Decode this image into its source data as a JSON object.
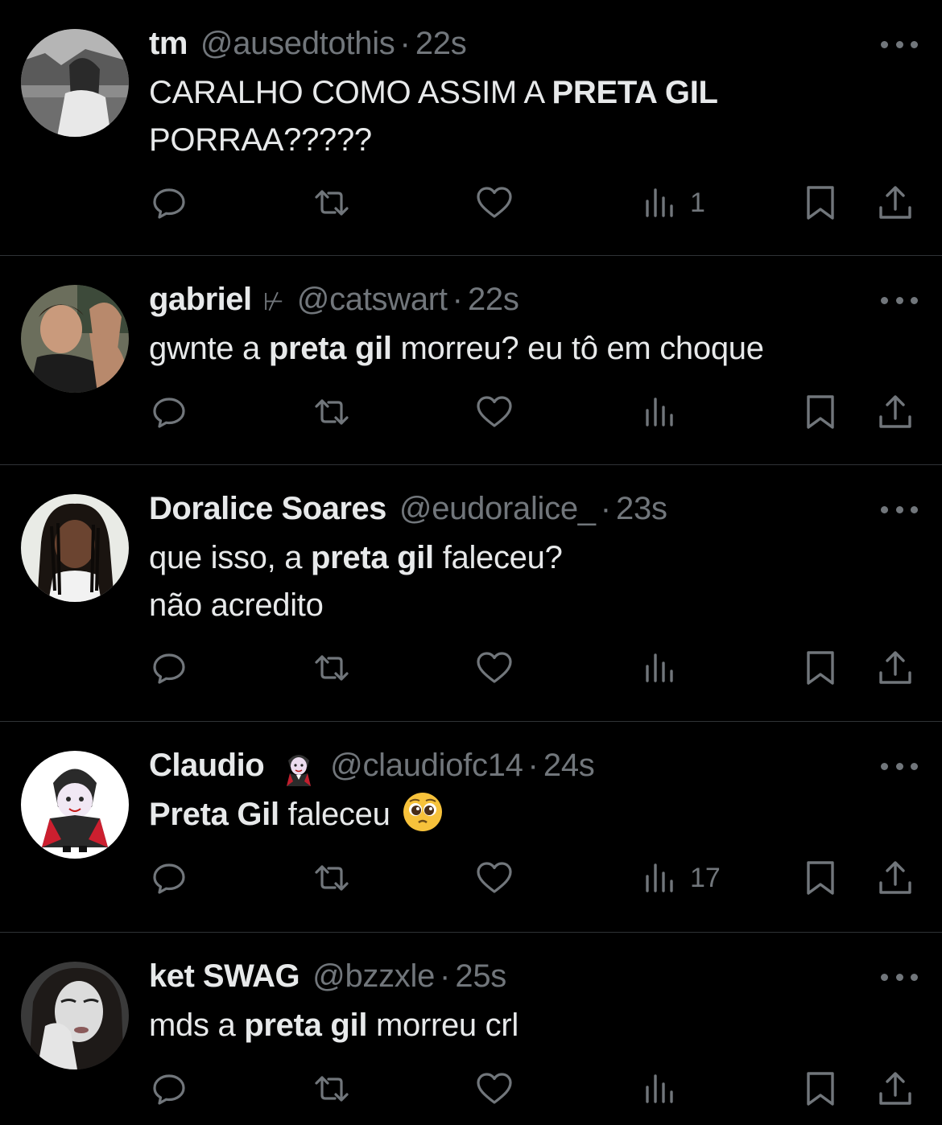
{
  "tweets": [
    {
      "name": "tm",
      "badge": "",
      "handle": "@ausedtothis",
      "separator": "·",
      "time": "22s",
      "lines": [
        [
          {
            "t": "CARALHO COMO ASSIM A ",
            "b": false
          },
          {
            "t": "PRETA GIL",
            "b": true
          }
        ],
        [
          {
            "t": "PORRAA?????",
            "b": false
          }
        ]
      ],
      "views": "1"
    },
    {
      "name": "gabriel",
      "badge": "⊬",
      "handle": "@catswart",
      "separator": "·",
      "time": "22s",
      "lines": [
        [
          {
            "t": "gwnte a ",
            "b": false
          },
          {
            "t": "preta gil",
            "b": true
          },
          {
            "t": " morreu? eu tô em choque",
            "b": false
          }
        ]
      ],
      "views": ""
    },
    {
      "name": "Doralice Soares",
      "badge": "",
      "handle": "@eudoralice_",
      "separator": "·",
      "time": "23s",
      "lines": [
        [
          {
            "t": "que isso, a ",
            "b": false
          },
          {
            "t": "preta gil",
            "b": true
          },
          {
            "t": " faleceu?",
            "b": false
          }
        ],
        [
          {
            "t": "não acredito",
            "b": false
          }
        ]
      ],
      "views": ""
    },
    {
      "name": "Claudio",
      "badge": "",
      "name_emoji": "vampire-emoji",
      "handle": "@claudiofc14",
      "separator": "·",
      "time": "24s",
      "lines": [
        [
          {
            "t": "Preta Gil",
            "b": true
          },
          {
            "t": " faleceu",
            "b": false
          }
        ]
      ],
      "text_emoji": "pleading-face-emoji",
      "views": "17"
    },
    {
      "name": "ket SWAG",
      "badge": "",
      "handle": "@bzzxle",
      "separator": "·",
      "time": "25s",
      "lines": [
        [
          {
            "t": "mds a ",
            "b": false
          },
          {
            "t": "preta gil",
            "b": true
          },
          {
            "t": " morreu crl",
            "b": false
          }
        ]
      ],
      "views": ""
    }
  ],
  "icons": {
    "reply": "reply-icon",
    "retweet": "retweet-icon",
    "like": "heart-icon",
    "views": "views-icon",
    "bookmark": "bookmark-icon",
    "share": "share-icon",
    "more": "more-icon"
  },
  "colors": {
    "background": "#000000",
    "text": "#e7e9ea",
    "secondary": "#71767b",
    "divider": "#2f3336"
  }
}
